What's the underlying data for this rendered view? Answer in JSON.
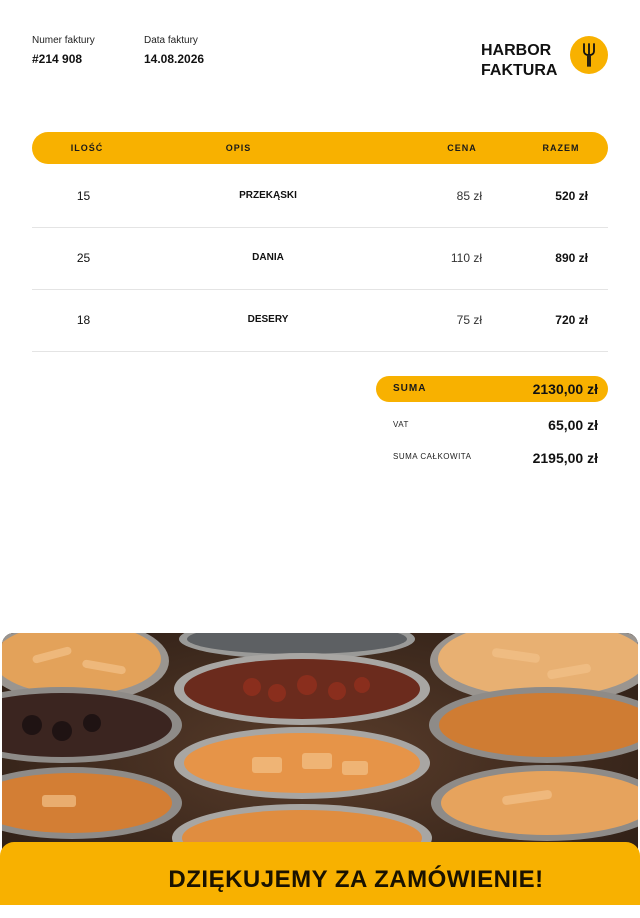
{
  "invoice": {
    "number_label": "Numer faktury",
    "number_value": "#214 908",
    "date_label": "Data faktury",
    "date_value": "14.08.2026"
  },
  "brand": {
    "line1": "HARBOR",
    "line2": "FAKTURA",
    "icon": "fork-icon"
  },
  "table": {
    "headers": {
      "qty": "ILOŚĆ",
      "desc": "OPIS",
      "price": "CENA",
      "total": "RAZEM"
    },
    "rows": [
      {
        "qty": "15",
        "desc": "PRZEKĄSKI",
        "price": "85 zł",
        "total": "520 zł"
      },
      {
        "qty": "25",
        "desc": "DANIA",
        "price": "110 zł",
        "total": "890 zł"
      },
      {
        "qty": "18",
        "desc": "DESERY",
        "price": "75 zł",
        "total": "720 zł"
      }
    ]
  },
  "totals": {
    "sum_label": "SUMA",
    "sum_value": "2130,00 zł",
    "vat_label": "VAT",
    "vat_value": "65,00 zł",
    "grand_label": "SUMA CAŁKOWITA",
    "grand_value": "2195,00 zł"
  },
  "footer": {
    "thank_you": "DZIĘKUJEMY ZA ZAMÓWIENIE!"
  },
  "colors": {
    "accent": "#f8b100",
    "text": "#111111"
  }
}
